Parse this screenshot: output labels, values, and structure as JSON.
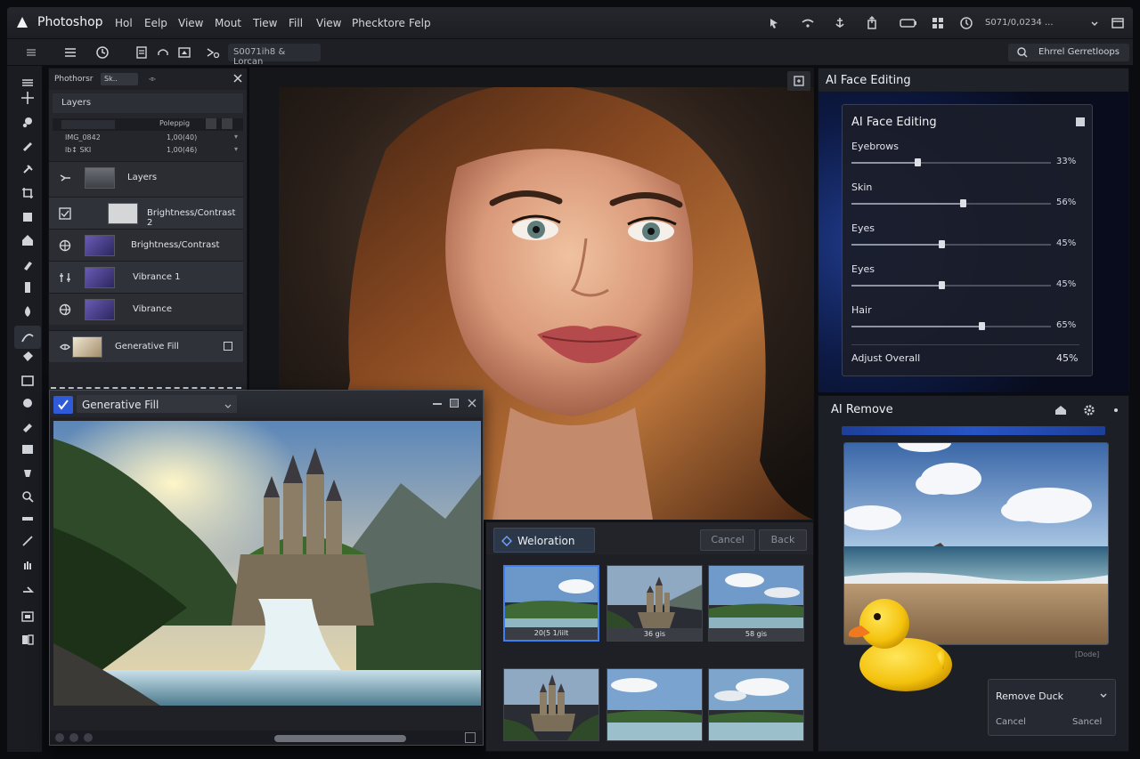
{
  "app": {
    "name": "Photoshop",
    "status": "S071/0,0234 ..."
  },
  "menu": [
    "Hol",
    "Eelp",
    "View",
    "Mout",
    "Tiew",
    "Fill",
    "View",
    "Phecktore",
    "Felp"
  ],
  "options_bar": {
    "field": "S0071ih8 & Lorcan",
    "search": "Ehrrel Gerretloops"
  },
  "layers_panel": {
    "tab": "Phothorsr",
    "dropdown": "Sk..",
    "header": "Layers",
    "mini_rows": [
      {
        "name": "",
        "value": "Poleppig"
      },
      {
        "name": "IMG_0842",
        "value": "1,00(40)"
      },
      {
        "name": "lb↕ SKI",
        "value": "1,00(46)"
      }
    ],
    "layers": [
      {
        "name": "Layers",
        "icon": "move-icon"
      },
      {
        "name": "Brightness/Contrast 2",
        "icon": "checkbox-icon"
      },
      {
        "name": "Brightness/Contrast",
        "icon": "target-icon"
      },
      {
        "name": "Vibrance 1",
        "icon": "adjust-icon"
      },
      {
        "name": "Vibrance",
        "icon": "globe-icon"
      },
      {
        "name": "Generative Fill",
        "icon": "sparkle-icon"
      }
    ]
  },
  "face_editing": {
    "panel_title": "AI Face Editing",
    "card_title": "AI Face Editing",
    "sliders": [
      {
        "label": "Eyebrows",
        "value": 33,
        "display": "33%"
      },
      {
        "label": "Skin",
        "value": 56,
        "display": "56%"
      },
      {
        "label": "Eyes",
        "value": 45,
        "display": "45%"
      },
      {
        "label": "Eyes",
        "value": 45,
        "display": "45%"
      },
      {
        "label": "Hair",
        "value": 65,
        "display": "65%"
      }
    ],
    "overall": {
      "label": "Adjust Overall",
      "display": "45%"
    }
  },
  "ai_remove": {
    "title": "AI Remove",
    "image_tag": "[Dode]",
    "popup_label": "Remove Duck",
    "cancel_1": "Cancel",
    "cancel_2": "Sancel"
  },
  "generative_fill": {
    "title": "Generative Fill"
  },
  "variations": {
    "tab": "Weloration",
    "cancel": "Cancel",
    "back": "Back",
    "thumbs": [
      {
        "caption": "20(5 1/iilt",
        "selected": true
      },
      {
        "caption": "36 gis",
        "selected": false
      },
      {
        "caption": "58 gis",
        "selected": false
      },
      {
        "caption": "",
        "selected": false
      },
      {
        "caption": "",
        "selected": false
      },
      {
        "caption": "",
        "selected": false
      }
    ]
  },
  "colors": {
    "accent": "#3f7ef0",
    "panel": "#24262c",
    "background": "#0b0c10"
  }
}
